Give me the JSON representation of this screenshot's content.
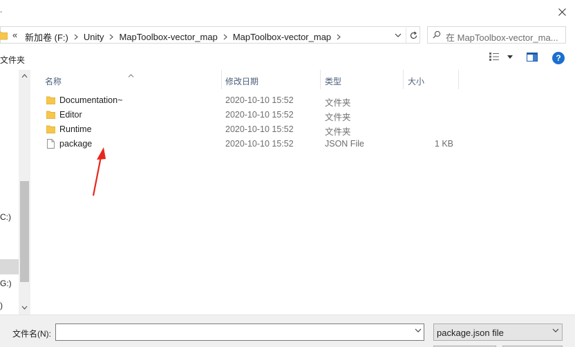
{
  "window": {
    "title_fragment": "-"
  },
  "address_bar": {
    "overflow_glyph": "«",
    "crumbs": [
      "新加卷 (F:)",
      "Unity",
      "MapToolbox-vector_map",
      "MapToolbox-vector_map"
    ]
  },
  "search": {
    "placeholder": "在 MapToolbox-vector_ma..."
  },
  "toolbar": {
    "label": "文件夹"
  },
  "nav": {
    "items": [
      "C:)",
      "G:)",
      ")"
    ]
  },
  "columns": {
    "name": "名称",
    "date": "修改日期",
    "type": "类型",
    "size": "大小"
  },
  "files": [
    {
      "name": "Documentation~",
      "modified": "2020-10-10 15:52",
      "type": "文件夹",
      "size": "",
      "icon": "folder-icon"
    },
    {
      "name": "Editor",
      "modified": "2020-10-10 15:52",
      "type": "文件夹",
      "size": "",
      "icon": "folder-icon"
    },
    {
      "name": "Runtime",
      "modified": "2020-10-10 15:52",
      "type": "文件夹",
      "size": "",
      "icon": "folder-icon"
    },
    {
      "name": "package",
      "modified": "2020-10-10 15:52",
      "type": "JSON File",
      "size": "1 KB",
      "icon": "file-icon"
    }
  ],
  "bottom": {
    "filename_label": "文件名(N):",
    "filename_value": "",
    "filetype_value": "package.json file"
  },
  "colors": {
    "folder": "#f7c64a",
    "annotation_arrow": "#e8271c",
    "help_button": "#1a6fcf",
    "header_text": "#4c607a"
  }
}
